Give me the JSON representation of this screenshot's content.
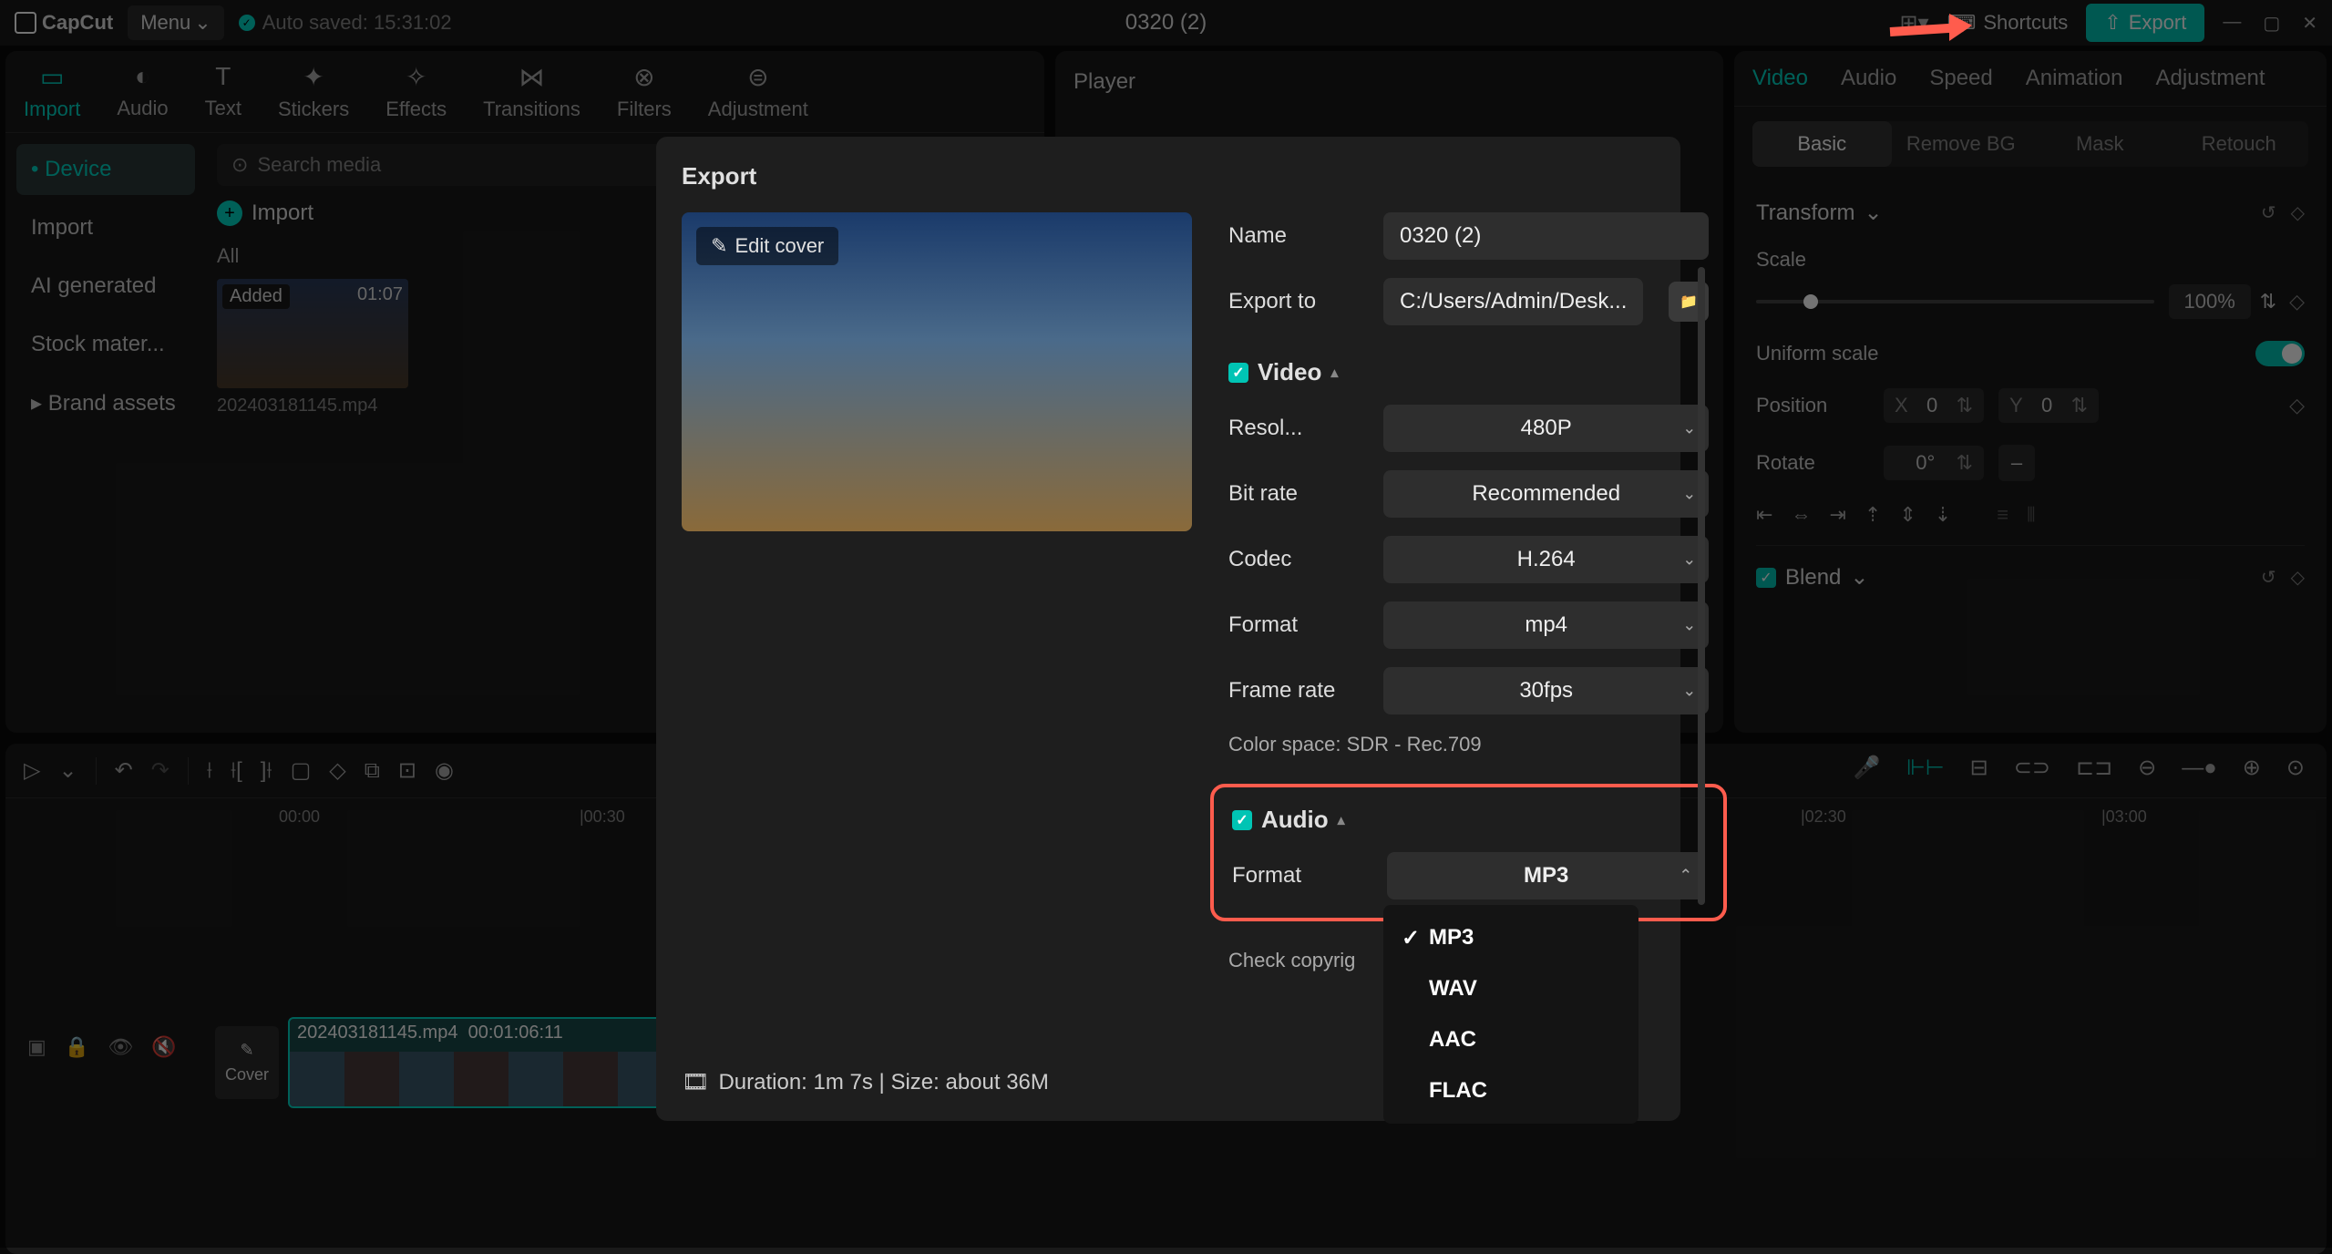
{
  "titlebar": {
    "app_name": "CapCut",
    "menu_label": "Menu",
    "autosave": "Auto saved: 15:31:02",
    "project_title": "0320 (2)",
    "shortcuts": "Shortcuts",
    "export": "Export"
  },
  "tool_tabs": [
    "Import",
    "Audio",
    "Text",
    "Stickers",
    "Effects",
    "Transitions",
    "Filters",
    "Adjustment"
  ],
  "sidebar": {
    "items": [
      "Device",
      "Import",
      "AI generated",
      "Stock mater...",
      "Brand assets"
    ]
  },
  "media": {
    "search_placeholder": "Search media",
    "import_label": "Import",
    "all_label": "All",
    "thumb": {
      "added": "Added",
      "duration": "01:07",
      "filename": "202403181145.mp4"
    }
  },
  "player": {
    "title": "Player"
  },
  "props": {
    "tabs": [
      "Video",
      "Audio",
      "Speed",
      "Animation",
      "Adjustment"
    ],
    "subtabs": [
      "Basic",
      "Remove BG",
      "Mask",
      "Retouch"
    ],
    "transform": "Transform",
    "scale": "Scale",
    "scale_value": "100%",
    "uniform": "Uniform scale",
    "position": "Position",
    "pos_x_label": "X",
    "pos_x": "0",
    "pos_y_label": "Y",
    "pos_y": "0",
    "rotate": "Rotate",
    "rotate_value": "0°",
    "blend": "Blend"
  },
  "timeline": {
    "marks": [
      "00:00",
      "|00:30",
      "|02:30",
      "|03:00"
    ],
    "cover": "Cover",
    "clip_name": "202403181145.mp4",
    "clip_time": "00:01:06:11"
  },
  "export_modal": {
    "title": "Export",
    "edit_cover": "Edit cover",
    "name_label": "Name",
    "name_value": "0320 (2)",
    "export_to_label": "Export to",
    "export_to_value": "C:/Users/Admin/Desk...",
    "video_section": "Video",
    "resolution_label": "Resol...",
    "resolution_value": "480P",
    "bitrate_label": "Bit rate",
    "bitrate_value": "Recommended",
    "codec_label": "Codec",
    "codec_value": "H.264",
    "format_label": "Format",
    "format_value": "mp4",
    "framerate_label": "Frame rate",
    "framerate_value": "30fps",
    "color_space": "Color space: SDR - Rec.709",
    "audio_section": "Audio",
    "audio_format_label": "Format",
    "audio_format_value": "MP3",
    "audio_options": [
      "MP3",
      "WAV",
      "AAC",
      "FLAC"
    ],
    "check_copyright": "Check copyrig",
    "footer_duration": "Duration: 1m 7s | Size: about 36M"
  }
}
